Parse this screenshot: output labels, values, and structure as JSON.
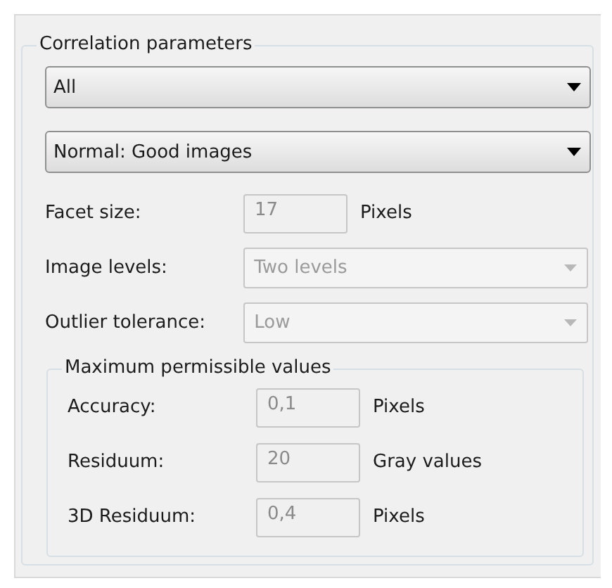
{
  "group": {
    "title": "Correlation parameters",
    "selectors": [
      {
        "value": "All",
        "disabled": false
      },
      {
        "value": "Normal: Good images",
        "disabled": false
      }
    ],
    "rows": [
      {
        "kind": "field",
        "label": "Facet size:",
        "value": "17",
        "unit": "Pixels",
        "disabled": true
      },
      {
        "kind": "dropdown",
        "label": "Image levels:",
        "value": "Two levels",
        "disabled": true
      },
      {
        "kind": "dropdown",
        "label": "Outlier tolerance:",
        "value": "Low",
        "disabled": true
      }
    ],
    "limits": {
      "title": "Maximum permissible values",
      "rows": [
        {
          "kind": "field",
          "label": "Accuracy:",
          "value": "0,1",
          "unit": "Pixels",
          "disabled": true
        },
        {
          "kind": "field",
          "label": "Residuum:",
          "value": "20",
          "unit": "Gray values",
          "disabled": true
        },
        {
          "kind": "field",
          "label": "3D Residuum:",
          "value": "0,4",
          "unit": "Pixels",
          "disabled": true
        }
      ]
    }
  }
}
